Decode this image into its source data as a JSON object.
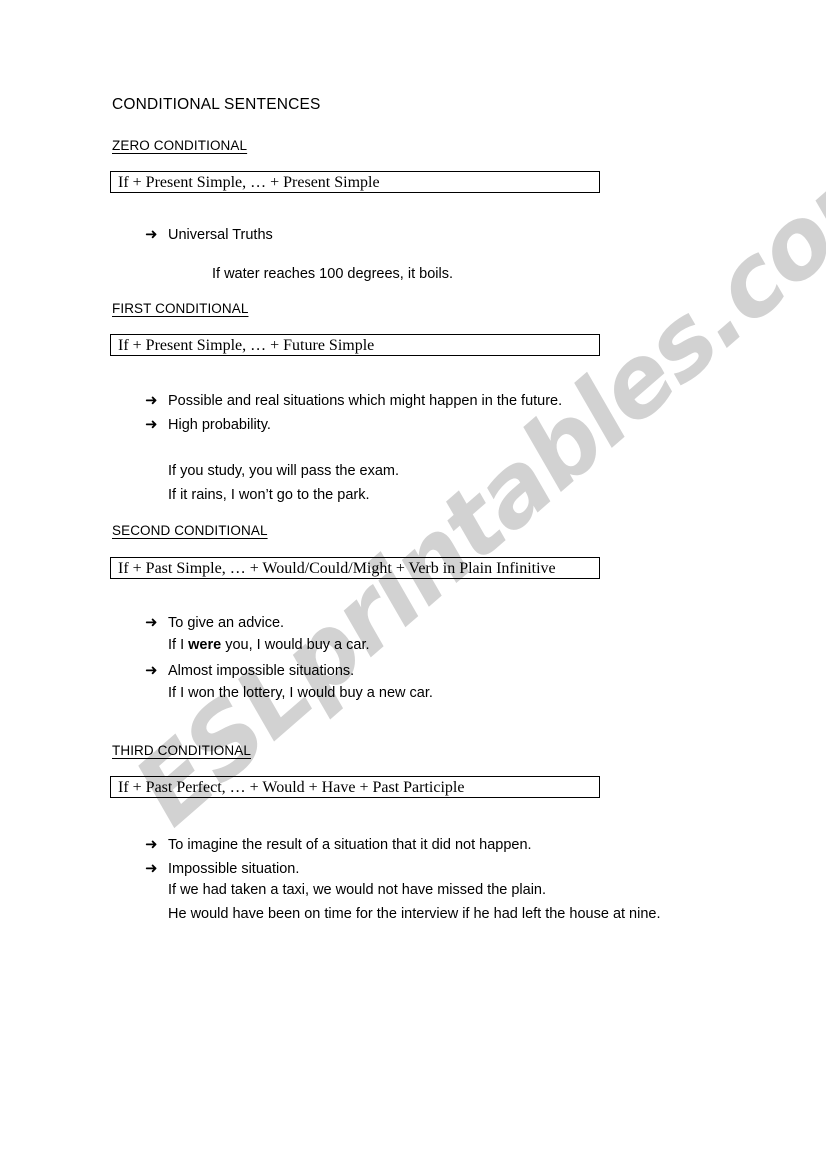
{
  "document": {
    "title": "CONDITIONAL SENTENCES",
    "watermark": "ESLprintables.com",
    "watermark_color": "#d2d2d2"
  },
  "sections": [
    {
      "heading": "ZERO CONDITIONAL",
      "formula": "If + Present Simple, … + Present Simple",
      "bullets": [
        "Universal Truths"
      ],
      "examples": [
        "If water reaches 100 degrees, it boils."
      ]
    },
    {
      "heading": "FIRST CONDITIONAL",
      "formula": "If + Present Simple, … + Future Simple",
      "bullets": [
        "Possible and real situations which might happen in the future.",
        "High probability."
      ],
      "examples": [
        "If you study, you will pass the exam.",
        "If it rains, I won’t go to the park."
      ]
    },
    {
      "heading": "SECOND CONDITIONAL",
      "formula": "If + Past Simple, … + Would/Could/Might + Verb in Plain Infinitive",
      "bullets": [
        "To give an advice.",
        "Almost impossible situations."
      ],
      "examples": [
        "If I were you, I would buy a car.",
        "If I won the lottery, I would buy a new car."
      ],
      "example_bold_word": "were"
    },
    {
      "heading": "THIRD CONDITIONAL",
      "formula": "If + Past Perfect, … + Would + Have + Past Participle",
      "bullets": [
        "To imagine the result of a situation that it did not happen.",
        "Impossible situation."
      ],
      "examples": [
        "If we had taken a taxi, we would not have missed the plain.",
        "He would have been on time for the interview if he had left the house at nine."
      ]
    }
  ],
  "icons": {
    "bullet_arrow": "➜"
  }
}
